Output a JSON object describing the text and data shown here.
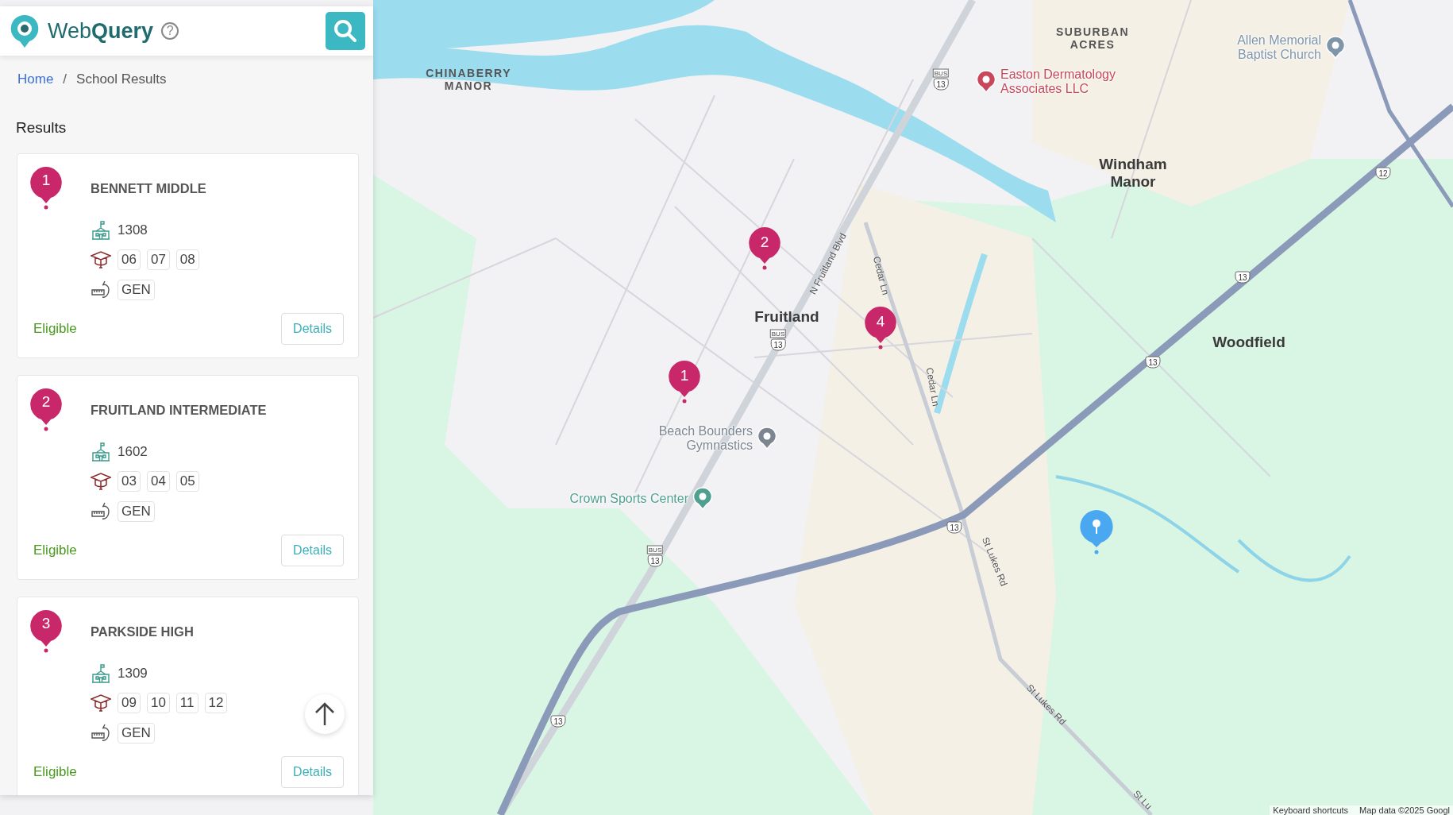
{
  "app": {
    "brand": "Web**Query**",
    "help": "?"
  },
  "breadcrumb": [
    {
      "label": "Home",
      "kind": "link"
    },
    {
      "label": "/",
      "kind": "separator"
    },
    {
      "label": "School Results",
      "kind": "current"
    }
  ],
  "results": {
    "title": "Results",
    "schools": [
      {
        "number": "1",
        "name": "BENNETT MIDDLE",
        "code": "1308",
        "grades": [
          "06",
          "07",
          "08"
        ],
        "programs": [
          "GEN"
        ],
        "status": "Eligible",
        "action": "Details"
      },
      {
        "number": "2",
        "name": "FRUITLAND INTERMEDIATE",
        "code": "1602",
        "grades": [
          "03",
          "04",
          "05"
        ],
        "programs": [
          "GEN"
        ],
        "status": "Eligible",
        "action": "Details"
      },
      {
        "number": "3",
        "name": "PARKSIDE HIGH",
        "code": "1309",
        "grades": [
          "09",
          "10",
          "11",
          "12"
        ],
        "programs": [
          "GEN"
        ],
        "status": "Eligible",
        "action": "Details"
      }
    ]
  },
  "map": {
    "places": [
      {
        "text": "CHINABERRY MANOR",
        "kind": "area"
      },
      {
        "text": "SUBURBAN ACRES",
        "kind": "area"
      },
      {
        "text": "Windham Manor",
        "kind": "town"
      },
      {
        "text": "Fruitland",
        "kind": "town"
      },
      {
        "text": "Woodfield",
        "kind": "town"
      },
      {
        "text": "Easton Dermatology Associates LLC",
        "kind": "poi",
        "color": "#c8475a"
      },
      {
        "text": "Allen Memorial Baptist Church",
        "kind": "poi",
        "color": "#7e95aa"
      },
      {
        "text": "Beach Bounders Gymnastics",
        "kind": "poi",
        "color": "#7b8691"
      },
      {
        "text": "Crown Sports Center",
        "kind": "poi",
        "color": "#4fa08e"
      }
    ],
    "roads": [
      "N Fruitland Blvd",
      "Cedar Ln",
      "Cedar Ln",
      "St Lukes Rd",
      "St Lukes Rd",
      "St Lu"
    ],
    "shields": [
      {
        "route": "13",
        "tag": "BUS"
      },
      {
        "route": "13",
        "tag": "BUS"
      },
      {
        "route": "13",
        "tag": "BUS"
      },
      {
        "route": "13"
      },
      {
        "route": "13"
      },
      {
        "route": "13"
      },
      {
        "route": "13"
      },
      {
        "route": "12"
      }
    ],
    "markers": [
      "2",
      "4",
      "1"
    ],
    "footer": [
      "Keyboard shortcuts",
      "Map data ©2025 Googl"
    ]
  }
}
